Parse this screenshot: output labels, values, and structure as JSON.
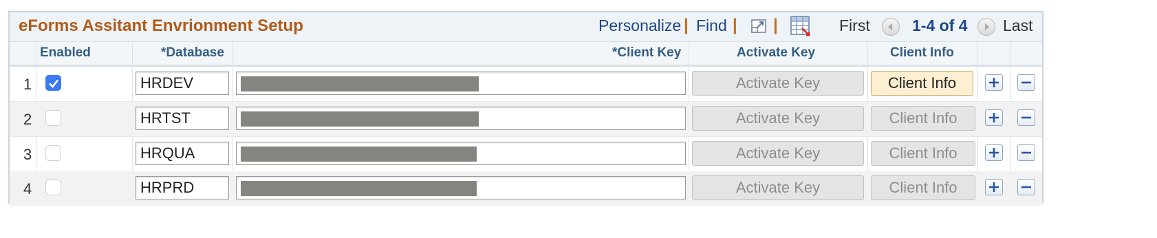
{
  "grid": {
    "title": "eForms Assitant Envrionment Setup",
    "nav": {
      "personalize": "Personalize",
      "find": "Find",
      "separator": "|",
      "first": "First",
      "range": "1-4 of 4",
      "last": "Last",
      "zoom_icon": "zoom-window-icon",
      "download_icon": "download-spreadsheet-icon"
    },
    "columns": {
      "enabled": "Enabled",
      "database": "Database",
      "client_key": "Client Key",
      "activate_key": "Activate Key",
      "client_info": "Client Info",
      "required_marker": "*"
    },
    "rows": [
      {
        "num": "1",
        "enabled": true,
        "database": "HRDEV",
        "activate_label": "Activate Key",
        "client_info_label": "Client Info",
        "client_info_active": true
      },
      {
        "num": "2",
        "enabled": false,
        "database": "HRTST",
        "activate_label": "Activate Key",
        "client_info_label": "Client Info",
        "client_info_active": false
      },
      {
        "num": "3",
        "enabled": false,
        "database": "HRQUA",
        "activate_label": "Activate Key",
        "client_info_label": "Client Info",
        "client_info_active": false
      },
      {
        "num": "4",
        "enabled": false,
        "database": "HRPRD",
        "activate_label": "Activate Key",
        "client_info_label": "Client Info",
        "client_info_active": false
      }
    ]
  },
  "colors": {
    "title": "#b25a17",
    "link": "#1d4688",
    "header_text": "#345e83",
    "checkbox_on": "#3d7bf3",
    "redaction": "#85857f",
    "active_button": "#fcefd2"
  }
}
